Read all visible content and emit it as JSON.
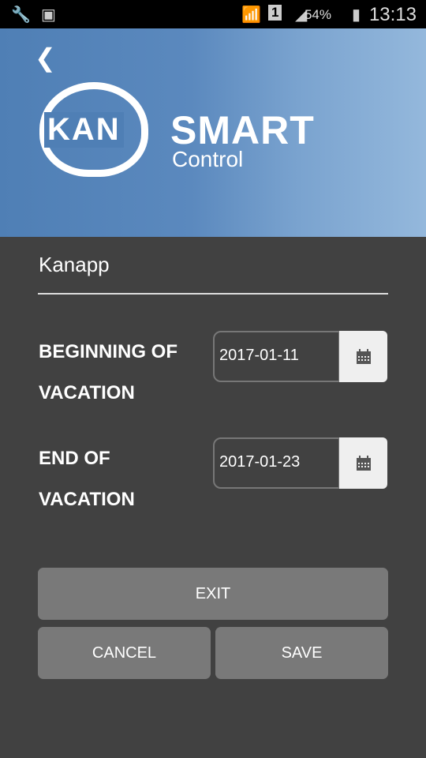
{
  "status_bar": {
    "battery": "54%",
    "time": "13:13",
    "sim": "1"
  },
  "header": {
    "logo_kan": "KAN",
    "logo_smart": "SMART",
    "logo_control": "Control"
  },
  "app_name": "Kanapp",
  "beginning": {
    "label": "BEGINNING OF VACATION",
    "value": "2017-01-11"
  },
  "end": {
    "label": "END OF VACATION",
    "value": "2017-01-23"
  },
  "buttons": {
    "exit": "EXIT",
    "cancel": "CANCEL",
    "save": "SAVE"
  }
}
